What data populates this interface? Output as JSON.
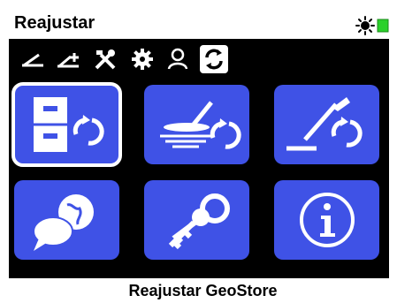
{
  "header": {
    "title": "Reajustar",
    "status_icons": [
      "sun-icon",
      "battery-icon"
    ],
    "battery_color": "#2bd12b"
  },
  "tabs": [
    {
      "name": "tab-threshold",
      "icon": "discrimination-icon"
    },
    {
      "name": "tab-ground-balance",
      "icon": "ground-balance-icon"
    },
    {
      "name": "tab-tools",
      "icon": "tools-icon"
    },
    {
      "name": "tab-settings",
      "icon": "gear-icon"
    },
    {
      "name": "tab-user",
      "icon": "user-icon"
    },
    {
      "name": "tab-reset",
      "icon": "reset-icon",
      "active": true
    }
  ],
  "tiles": [
    {
      "name": "reset-geostore-tile",
      "icon": "filing-cabinet-reset-icon",
      "selected": true
    },
    {
      "name": "reset-detect-settings-tile",
      "icon": "coil-reset-icon",
      "selected": false
    },
    {
      "name": "reset-search-modes-tile",
      "icon": "detector-reset-icon",
      "selected": false
    },
    {
      "name": "language-tile",
      "icon": "globe-chat-icon",
      "selected": false
    },
    {
      "name": "keys-tile",
      "icon": "keys-icon",
      "selected": false
    },
    {
      "name": "info-tile",
      "icon": "info-icon",
      "selected": false
    }
  ],
  "footer": {
    "label": "Reajustar GeoStore"
  },
  "colors": {
    "tile": "#3f52e6",
    "panel": "#000000",
    "selection": "#ffffff"
  }
}
